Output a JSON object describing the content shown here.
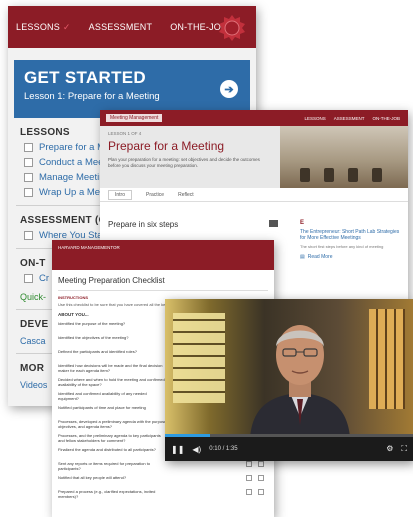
{
  "app": {
    "nav": {
      "lessons": "LESSONS",
      "assessment": "ASSESSMENT",
      "on_the_job": "ON-THE-JOB"
    },
    "banner": {
      "title": "GET STARTED",
      "subtitle": "Lesson 1: Prepare for a Meeting"
    },
    "lessons_header": "LESSONS",
    "lessons": [
      "Prepare for a Mee",
      "Conduct a Meetin",
      "Manage Meeting",
      "Wrap Up a Meeti"
    ],
    "assessment_header": "ASSESSMENT (O",
    "assessment_items": [
      "Where You Stand"
    ],
    "onthejob_header": "ON-T",
    "onthejob_items": [
      "Cr"
    ],
    "quick_link": "Quick-",
    "dev_header": "DEVE",
    "dev_link": "Casca",
    "more_header": "MOR",
    "more_link": "Videos"
  },
  "lesson_page": {
    "crumb": "Meeting Management",
    "top_links": [
      "LESSONS",
      "ASSESSMENT",
      "ON-THE-JOB"
    ],
    "kicker": "LESSON 1 OF 4",
    "title": "Prepare for a Meeting",
    "description": "Plan your preparation for a meeting: set objectives and decide the outcomes before you discuss your meeting preparation.",
    "tabs": [
      "Intro",
      "Practice",
      "Reflect"
    ],
    "steps_label": "Prepare in six steps",
    "side_brand": "E",
    "side_title": "The Entrepreneur: Short Path Lab Strategies for More Effective Meetings",
    "side_meta": "The short first steps before any kind of meeting",
    "read_more": "Read More"
  },
  "checklist": {
    "header_text": "HARVARD MANAGEMENTOR",
    "title": "Meeting Preparation Checklist",
    "instructions_head": "INSTRUCTIONS",
    "instructions": "Use this checklist to be sure that you have covered all the key points.",
    "about_head": "ABOUT YOU...",
    "rows": [
      "Identified the purpose of the meeting?",
      "Identified the objectives of the meeting?",
      "Defined the participants and identified roles?",
      "Identified how decisions will be made and the final decision maker for each agenda item?",
      "Decided where and when to hold the meeting and confirmed availability of the space?",
      "Identified and confirmed availability of any needed equipment?",
      "Notified participants of time and place for meeting",
      "Processes, developed a preliminary agenda with the purpose, objectives, and agenda items?",
      "Processes, and the preliminary agenda to key participants and fellow stakeholders for comment?",
      "Finalized the agenda and distributed to all participants?",
      "Sent any reports or items required for preparation to participants?",
      "Notified that all key people will attend?",
      "Prepared a process (e.g., clarified expectations, invited members)?"
    ]
  },
  "video": {
    "time": "0:10 / 1:35",
    "progress_pct": 18
  }
}
